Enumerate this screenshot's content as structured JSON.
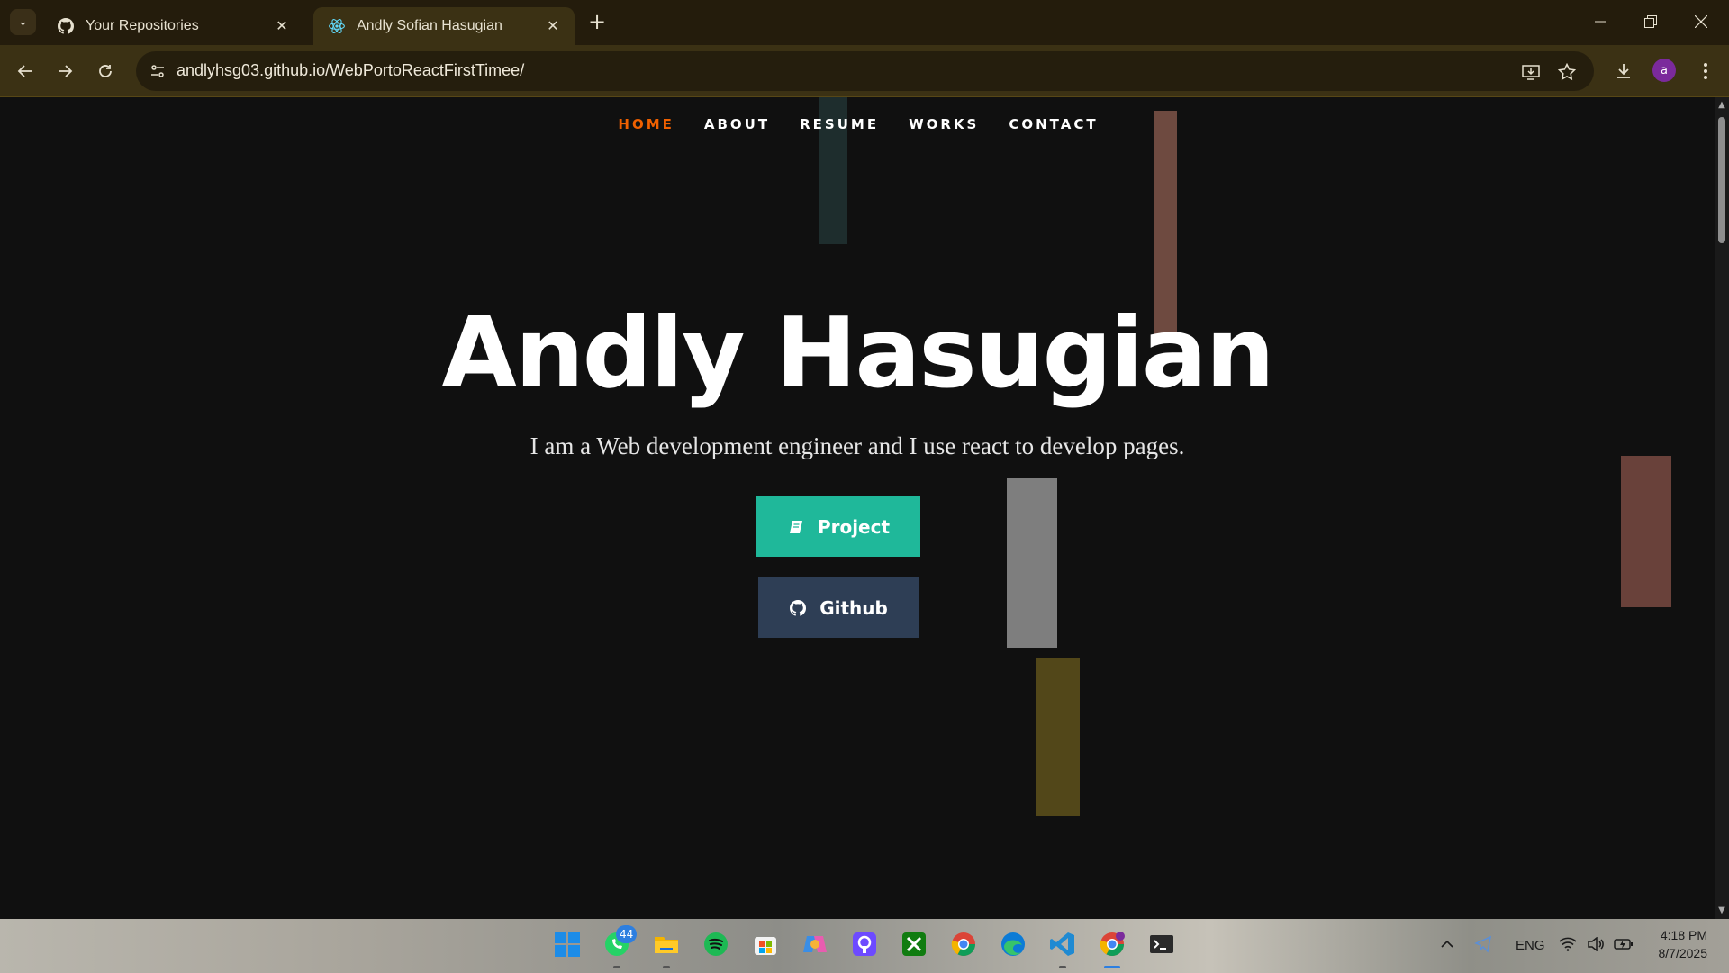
{
  "browser": {
    "tabs": [
      {
        "title": "Your Repositories",
        "icon": "github-icon"
      },
      {
        "title": "Andly Sofian Hasugian",
        "icon": "react-icon",
        "active": true
      }
    ],
    "url": "andlyhsg03.github.io/WebPortoReactFirstTimee/",
    "profile_initial": "a"
  },
  "nav": {
    "items": [
      "HOME",
      "ABOUT",
      "RESUME",
      "WORKS",
      "CONTACT"
    ],
    "active": "HOME",
    "active_color": "#f06000"
  },
  "hero": {
    "name": "Andly Hasugian",
    "subtitle": "I am a Web development engineer and I use react to develop pages.",
    "buttons": {
      "project_label": "Project",
      "github_label": "Github"
    }
  },
  "colors": {
    "project_button": "#1fb89a",
    "github_button": "#2e3e55",
    "background": "#101010"
  },
  "taskbar": {
    "whatsapp_badge": "44",
    "language": "ENG",
    "time": "4:18 PM",
    "date": "8/7/2025",
    "icons": [
      "windows-start-icon",
      "whatsapp-icon",
      "file-explorer-icon",
      "spotify-icon",
      "microsoft-store-icon",
      "copilot-icon",
      "proton-pass-icon",
      "xbox-icon",
      "chrome-icon",
      "edge-icon",
      "vscode-icon",
      "chrome-profile-icon",
      "terminal-icon"
    ]
  }
}
